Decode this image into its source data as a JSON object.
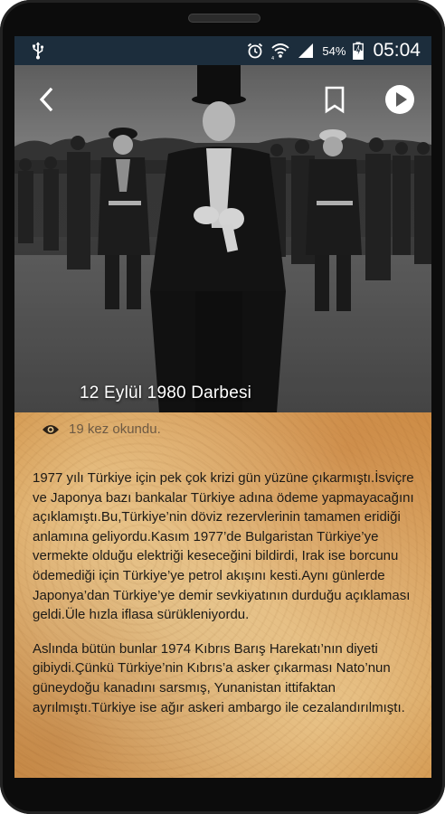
{
  "status_bar": {
    "battery_percent": "54%",
    "time": "05:04",
    "icons": [
      "usb-icon",
      "alarm-icon",
      "wifi-icon",
      "signal-icon",
      "battery-charging-icon"
    ]
  },
  "header": {
    "title": "12 Eylül 1980 Darbesi",
    "icons": [
      "back-arrow-icon",
      "bookmark-icon",
      "play-circle-icon"
    ]
  },
  "article": {
    "read_count": "19 kez okundu.",
    "paragraphs": [
      "1977 yılı Türkiye için pek çok krizi gün yüzüne çıkarmıştı.İsviçre ve Japonya bazı bankalar Türkiye adına ödeme yapmayacağını açıklamıştı.Bu,Türkiye’nin döviz rezervlerinin tamamen eridiği anlamına geliyordu.Kasım 1977’de Bulgaristan Türkiye’ye vermekte olduğu elektriği keseceğini bildirdi, Irak ise borcunu ödemediği için Türkiye’ye petrol akışını kesti.Aynı günlerde Japonya’dan Türkiye’ye demir sevkiyatının durduğu açıklaması geldi.Üle hızla iflasa sürükleniyordu.",
      "Aslında bütün bunlar 1974 Kıbrıs Barış Harekatı’nın diyeti gibiydi.Çünkü Türkiye’nin Kıbrıs’a asker çıkarması Nato’nun güneydoğu kanadını sarsmış, Yunanistan ittifaktan ayrılmıştı.Türkiye ise ağır askeri ambargo ile cezalandırılmıştı."
    ]
  }
}
